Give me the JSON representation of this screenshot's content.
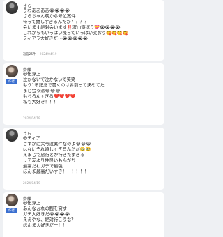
{
  "posts": [
    {
      "username": "さら",
      "lines": [
        "うわああああ😭😭😭😭",
        "さらちゃん朝から号泣案件",
        "待って嬉しすぎるんだが？？？？",
        "会います絶対会います‼️沢山遊ぼう💝😭😭😭😭",
        "これからもいっぱい喋っていっぱい笑おう🥰🥰🥰🥰",
        "ティアラ大好きだ〜😭😭😭😭😭"
      ],
      "tag": "返信25件",
      "date": "2024/04/19"
    },
    {
      "username": "齋藤",
      "badge": "作者",
      "lines": [
        "@伍浮上",
        "泣かないで泣かないで笑笑",
        "もう1年記念で書くのはお前って決めてた",
        "まじ会う派😂😂😂",
        "もちろんすぎる❤️❤️❤️❤️",
        "私も大好き！！！"
      ],
      "date": "2024/04/19"
    },
    {
      "username": "さら",
      "lines": [
        "@ティア",
        "さすがに大号泣案件なのよ😭😭😭",
        "はなにそれ嬉しすぎるんだが🥹🥹",
        "えまじで旅行とか行きたすぎる",
        "リア友より仲良いもんがち",
        "最高だわガチで最強",
        "ほんま最高だいすき！！！！！！"
      ],
      "date": "2024/04/19"
    },
    {
      "username": "齋藤",
      "badge": "作者",
      "lines": [
        "@伍浮上",
        "あんなぉれの腕を貸す",
        "ガチ大好きだ😭😭😭😭",
        "ええやな、絶対行こうな？",
        "ほんま大好きだー！！！"
      ]
    }
  ]
}
